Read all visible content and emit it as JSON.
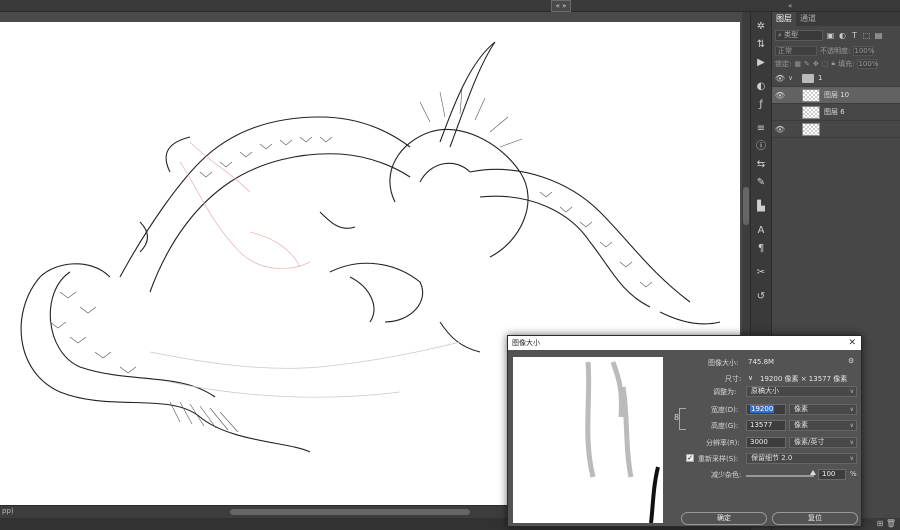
{
  "topbar": {
    "arrange_glyph": "« »",
    "collapse_glyph": "«"
  },
  "status": {
    "zoom": "pp)"
  },
  "toolstrip": {
    "icons": [
      "settings-icon",
      "adjust-icon",
      "play-icon",
      "color-icon",
      "fx-icon",
      "properties-icon",
      "info-icon",
      "brush-settings-icon",
      "clone-source-icon",
      "histogram-icon",
      "character-icon",
      "paragraph-icon",
      "tools-icon",
      "history-icon"
    ]
  },
  "layers_panel": {
    "tabs": [
      "图层",
      "通道"
    ],
    "filter_placeholder": "类型",
    "blend_mode": "正常",
    "opacity_label": "不透明度:",
    "opacity_value": "100%",
    "lock_label": "锁定:",
    "fill_label": "填充:",
    "fill_value": "100%",
    "layers": [
      {
        "name": "1",
        "type": "group"
      },
      {
        "name": "图层 10",
        "type": "layer",
        "selected": true
      },
      {
        "name": "图层 6",
        "type": "layer"
      },
      {
        "name": "",
        "type": "layer"
      }
    ]
  },
  "dialog": {
    "title": "图像大小",
    "image_size_label": "图像大小:",
    "image_size_value": "745.8M",
    "dimensions_label": "尺寸:",
    "dimensions_value": "19200 像素 × 13577 像素",
    "fit_label": "调整为:",
    "fit_value": "原稿大小",
    "width_label": "宽度(D):",
    "width_value": "19200",
    "width_unit": "像素",
    "height_label": "高度(G):",
    "height_value": "13577",
    "height_unit": "像素",
    "resolution_label": "分辨率(R):",
    "resolution_value": "3000",
    "resolution_unit": "像素/英寸",
    "resample_label": "重新采样(S):",
    "resample_value": "保留细节 2.0",
    "resample_checked": true,
    "noise_label": "减少杂色:",
    "noise_value": "100",
    "noise_unit": "%",
    "ok_label": "确定",
    "reset_label": "复位"
  }
}
